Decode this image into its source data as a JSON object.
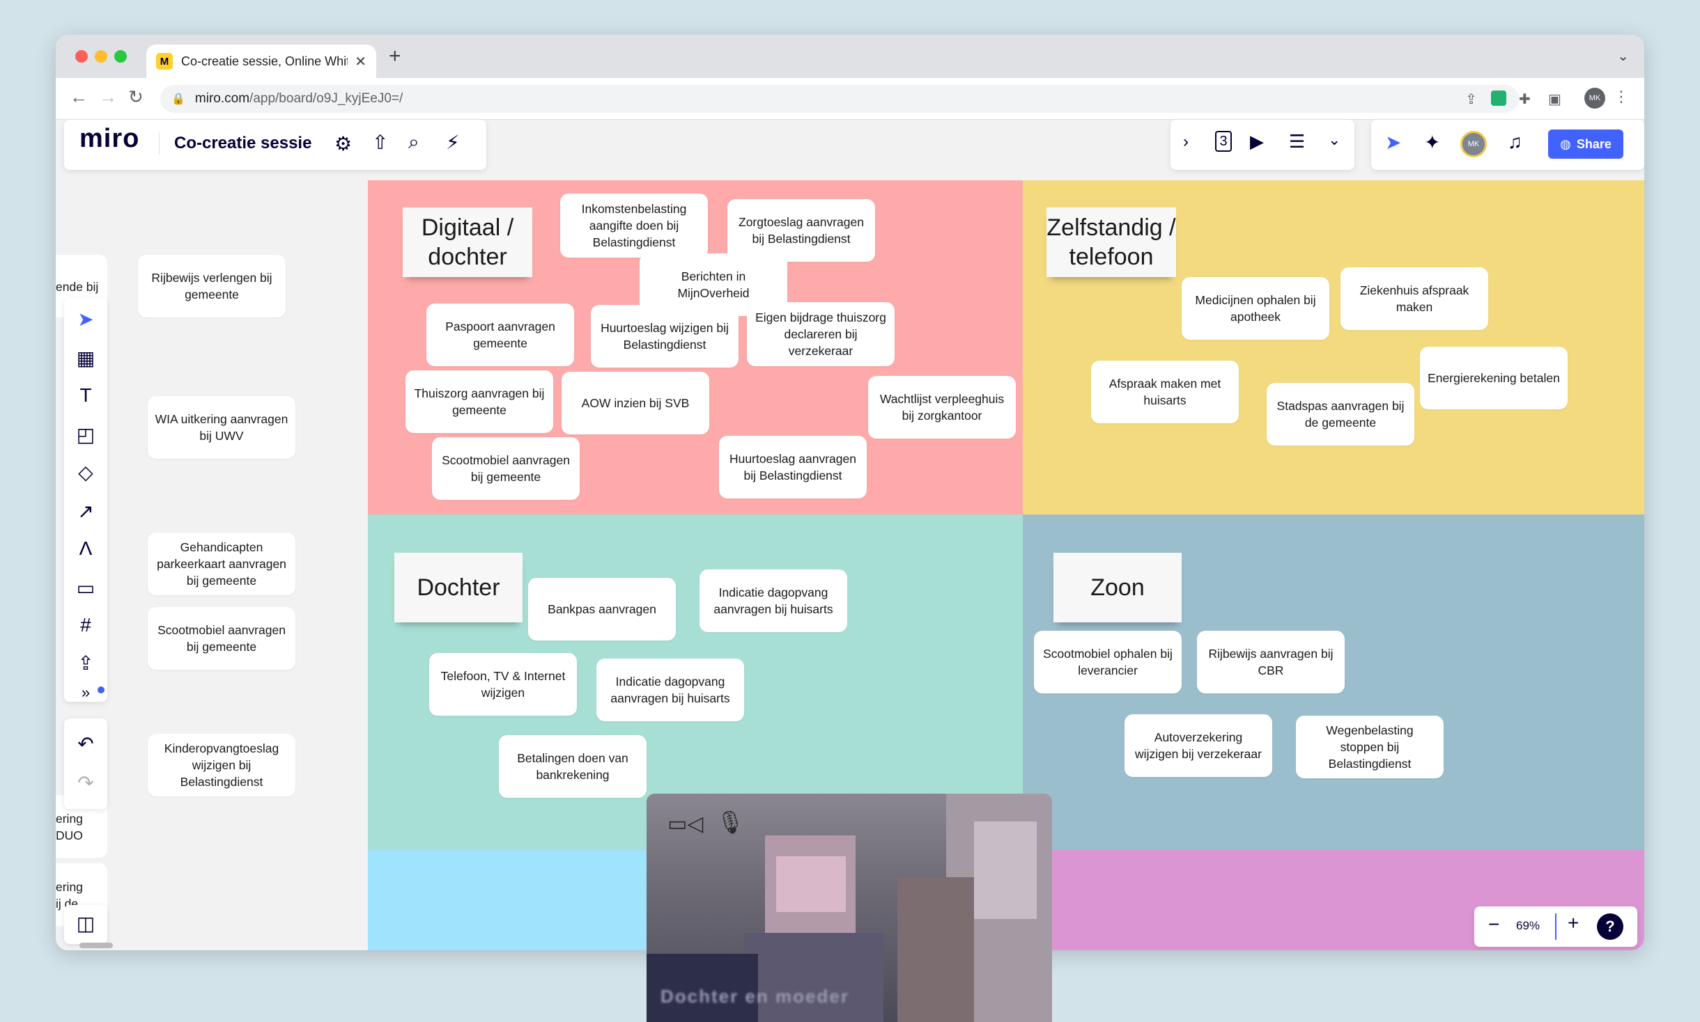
{
  "browser": {
    "tab_title": "Co-creatie sessie, Online Whit",
    "tab_favicon": "M",
    "url_host": "miro.com",
    "url_path": "/app/board/o9J_kyjEeJ0=/",
    "profile_initials": "MK"
  },
  "miro": {
    "logo": "miro",
    "board_title": "Co-creatie sessie",
    "page_count": "3",
    "share_label": "Share",
    "avatar_initials": "MK",
    "zoom": "69%",
    "help": "?"
  },
  "left_cards": [
    "Rijbewijs verlengen bij gemeente",
    "WIA uitkering aanvragen bij UWV",
    "Gehandicapten parkeerkaart aanvragen bij gemeente",
    "Scootmobiel aanvragen bij gemeente",
    "Kinderopvangtoeslag wijzigen bij Belastingdienst"
  ],
  "left_clipped": [
    "ende bij",
    "ering\nDUO",
    "ering\nij de"
  ],
  "zones": {
    "digitaal_dochter": {
      "title": "Digitaal / dochter",
      "cards": [
        "Inkomstenbelasting aangifte doen bij Belastingdienst",
        "Zorgtoeslag aanvragen bij Belastingdienst",
        "Berichten in MijnOverheid",
        "Paspoort aanvragen gemeente",
        "Huurtoeslag wijzigen bij Belastingdienst",
        "Eigen bijdrage thuiszorg declareren bij verzekeraar",
        "Thuiszorg aanvragen bij gemeente",
        "AOW inzien bij SVB",
        "Wachtlijst verpleeghuis bij zorgkantoor",
        "Scootmobiel aanvragen bij gemeente",
        "Huurtoeslag aanvragen bij Belastingdienst"
      ]
    },
    "zelfstandig_telefoon": {
      "title": "Zelfstandig / telefoon",
      "cards": [
        "Medicijnen ophalen bij apotheek",
        "Ziekenhuis afspraak maken",
        "Afspraak maken met huisarts",
        "Energierekening betalen",
        "Stadspas aanvragen bij de gemeente"
      ]
    },
    "dochter": {
      "title": "Dochter",
      "cards": [
        "Bankpas aanvragen",
        "Indicatie dagopvang aanvragen bij huisarts",
        "Telefoon, TV & Internet wijzigen",
        "Indicatie dagopvang aanvragen bij huisarts",
        "Betalingen doen van bankrekening"
      ]
    },
    "zoon": {
      "title": "Zoon",
      "cards": [
        "Scootmobiel ophalen bij leverancier",
        "Rijbewijs aanvragen bij CBR",
        "Autoverzekering wijzigen bij verzekeraar",
        "Wegenbelasting stoppen bij Belastingdienst"
      ]
    }
  },
  "video": {
    "caption": "Dochter en moeder"
  },
  "colors": {
    "pink": "#ffaaaa",
    "yellow": "#f3da7f",
    "mint": "#a8dfd5",
    "blue": "#9bbecd",
    "sky": "#9fe3fc",
    "purple": "#dc95d3",
    "accent": "#4262ff"
  }
}
